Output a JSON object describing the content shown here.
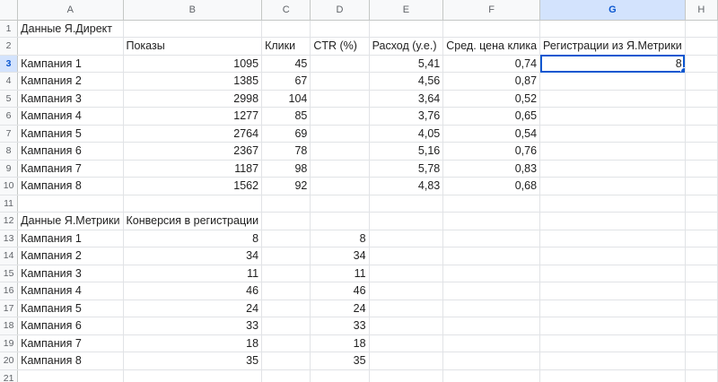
{
  "columns": [
    "A",
    "B",
    "C",
    "D",
    "E",
    "F",
    "G",
    "H"
  ],
  "selected_column": "G",
  "selected_row": 3,
  "rows": [
    {
      "n": "1",
      "cells": [
        "Данные Я.Директ",
        "",
        "",
        "",
        "",
        "",
        "",
        ""
      ]
    },
    {
      "n": "2",
      "cells": [
        "",
        "Показы",
        "Клики",
        "CTR (%)",
        "Расход (у.е.)",
        "Сред. цена клика",
        "Регистрации из Я.Метрики",
        ""
      ]
    },
    {
      "n": "3",
      "cells": [
        "Кампания 1",
        "1095",
        "45",
        "",
        "5,41",
        "0,74",
        "8",
        ""
      ]
    },
    {
      "n": "4",
      "cells": [
        "Кампания 2",
        "1385",
        "67",
        "",
        "4,56",
        "0,87",
        "",
        ""
      ]
    },
    {
      "n": "5",
      "cells": [
        "Кампания 3",
        "2998",
        "104",
        "",
        "3,64",
        "0,52",
        "",
        ""
      ]
    },
    {
      "n": "6",
      "cells": [
        "Кампания 4",
        "1277",
        "85",
        "",
        "3,76",
        "0,65",
        "",
        ""
      ]
    },
    {
      "n": "7",
      "cells": [
        "Кампания 5",
        "2764",
        "69",
        "",
        "4,05",
        "0,54",
        "",
        ""
      ]
    },
    {
      "n": "8",
      "cells": [
        "Кампания 6",
        "2367",
        "78",
        "",
        "5,16",
        "0,76",
        "",
        ""
      ]
    },
    {
      "n": "9",
      "cells": [
        "Кампания 7",
        "1187",
        "98",
        "",
        "5,78",
        "0,83",
        "",
        ""
      ]
    },
    {
      "n": "10",
      "cells": [
        "Кампания 8",
        "1562",
        "92",
        "",
        "4,83",
        "0,68",
        "",
        ""
      ]
    },
    {
      "n": "11",
      "cells": [
        "",
        "",
        "",
        "",
        "",
        "",
        "",
        ""
      ]
    },
    {
      "n": "12",
      "cells": [
        "Данные Я.Метрики",
        "Конверсия в регистрации",
        "",
        "",
        "",
        "",
        "",
        ""
      ]
    },
    {
      "n": "13",
      "cells": [
        "Кампания 1",
        "8",
        "",
        "8",
        "",
        "",
        "",
        ""
      ]
    },
    {
      "n": "14",
      "cells": [
        "Кампания 2",
        "34",
        "",
        "34",
        "",
        "",
        "",
        ""
      ]
    },
    {
      "n": "15",
      "cells": [
        "Кампания 3",
        "11",
        "",
        "11",
        "",
        "",
        "",
        ""
      ]
    },
    {
      "n": "16",
      "cells": [
        "Кампания 4",
        "46",
        "",
        "46",
        "",
        "",
        "",
        ""
      ]
    },
    {
      "n": "17",
      "cells": [
        "Кампания 5",
        "24",
        "",
        "24",
        "",
        "",
        "",
        ""
      ]
    },
    {
      "n": "18",
      "cells": [
        "Кампания 6",
        "33",
        "",
        "33",
        "",
        "",
        "",
        ""
      ]
    },
    {
      "n": "19",
      "cells": [
        "Кампания 7",
        "18",
        "",
        "18",
        "",
        "",
        "",
        ""
      ]
    },
    {
      "n": "20",
      "cells": [
        "Кампания 8",
        "35",
        "",
        "35",
        "",
        "",
        "",
        ""
      ]
    },
    {
      "n": "21",
      "cells": [
        "",
        "",
        "",
        "",
        "",
        "",
        "",
        ""
      ]
    }
  ]
}
